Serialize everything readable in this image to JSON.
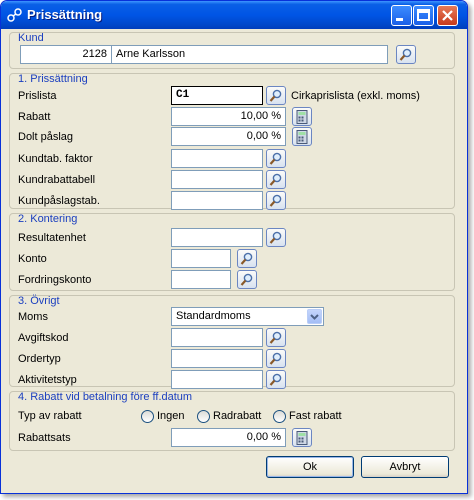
{
  "window": {
    "title": "Prissättning"
  },
  "kund": {
    "group_title": "Kund",
    "number": "2128",
    "name": "Arne Karlsson"
  },
  "prissattning": {
    "group_title": "1. Prissättning",
    "prislista_label": "Prislista",
    "prislista_value": "C1",
    "prislista_desc": "Cirkaprislista (exkl. moms)",
    "rabatt_label": "Rabatt",
    "rabatt_value": "10,00 %",
    "dolt_label": "Dolt påslag",
    "dolt_value": "0,00 %",
    "kundtab_label": "Kundtab. faktor",
    "kundrabatt_label": "Kundrabattabell",
    "kundpaslag_label": "Kundpåslagstab."
  },
  "kontering": {
    "group_title": "2. Kontering",
    "resultatenhet_label": "Resultatenhet",
    "konto_label": "Konto",
    "fordringskonto_label": "Fordringskonto"
  },
  "ovrigt": {
    "group_title": "3. Övrigt",
    "moms_label": "Moms",
    "moms_value": "Standardmoms",
    "avgiftskod_label": "Avgiftskod",
    "ordertyp_label": "Ordertyp",
    "aktivitetstyp_label": "Aktivitetstyp"
  },
  "rabatt_betalning": {
    "group_title": "4. Rabatt vid betalning före ff.datum",
    "typ_label": "Typ av rabatt",
    "options": [
      "Ingen",
      "Radrabatt",
      "Fast rabatt"
    ],
    "rabattsats_label": "Rabattsats",
    "rabattsats_value": "0,00 %"
  },
  "buttons": {
    "ok": "Ok",
    "avbryt": "Avbryt"
  }
}
